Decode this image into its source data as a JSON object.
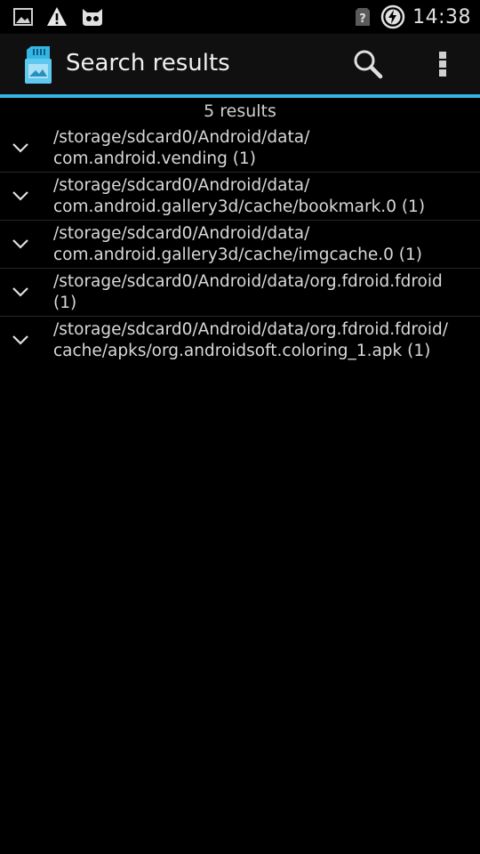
{
  "status_bar": {
    "time": "14:38",
    "icons": [
      "image-icon",
      "warning-icon",
      "cyanogen-mascot-icon",
      "sim-unknown-icon",
      "battery-charging-icon"
    ]
  },
  "action_bar": {
    "title": "Search results",
    "app_icon": "sdcard-icon",
    "search_icon": "search-icon",
    "overflow_icon": "overflow-menu-icon"
  },
  "results": {
    "count_label": "5 results",
    "items": [
      {
        "line1": "/storage/sdcard0/Android/data/",
        "line2": "com.android.vending (1)"
      },
      {
        "line1": "/storage/sdcard0/Android/data/",
        "line2": "com.android.gallery3d/cache/bookmark.0 (1)"
      },
      {
        "line1": "/storage/sdcard0/Android/data/",
        "line2": "com.android.gallery3d/cache/imgcache.0 (1)"
      },
      {
        "line1": "/storage/sdcard0/Android/data/org.fdroid.fdroid",
        "line2": "(1)"
      },
      {
        "line1": "/storage/sdcard0/Android/data/org.fdroid.fdroid/",
        "line2": "cache/apks/org.androidsoft.coloring_1.apk (1)"
      }
    ]
  },
  "colors": {
    "accent": "#33b5e5",
    "background": "#000000",
    "actionbar": "#101010"
  }
}
